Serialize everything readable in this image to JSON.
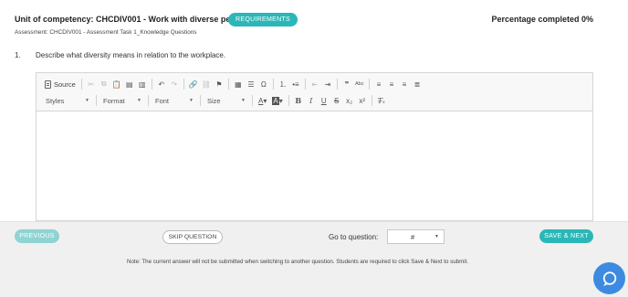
{
  "header": {
    "unit_title": "Unit of competency: CHCDIV001 - Work with diverse people",
    "requirements_label": "REQUIREMENTS",
    "percentage": "Percentage completed 0%",
    "assessment": "Assessment: CHCDIV001 - Assessment Task 1_Knowledge Questions"
  },
  "question": {
    "number": "1.",
    "text": "Describe what diversity means in relation to the workplace."
  },
  "editor": {
    "source_label": "Source",
    "styles_label": "Styles",
    "format_label": "Format",
    "font_label": "Font",
    "size_label": "Size",
    "content": ""
  },
  "footer": {
    "previous_label": "PREVIOUS",
    "skip_label": "SKIP QUESTION",
    "goto_label": "Go to question:",
    "goto_value": "#",
    "save_label": "SAVE & NEXT",
    "note": "Note: The current answer will not be submitted when switching to another question. Students are required to click Save & Next to submit."
  },
  "colors": {
    "accent": "#2bb7b7",
    "accent_disabled": "#8fd3d3",
    "chat": "#3d8be0"
  }
}
